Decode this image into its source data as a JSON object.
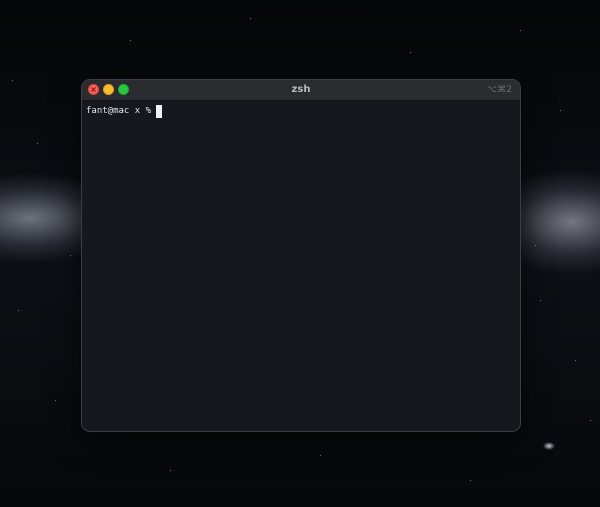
{
  "window": {
    "title": "zsh",
    "shortcut": "⌥⌘2"
  },
  "terminal": {
    "prompt": "fant@mac x %",
    "input": ""
  },
  "colors": {
    "background": "#16181d",
    "titlebar": "#2b2c30",
    "close": "#fe5f57",
    "minimize": "#febc2e",
    "maximize": "#28c840",
    "text": "#e6e6e6"
  },
  "icons": {
    "close": "close-icon",
    "minimize": "minimize-icon",
    "maximize": "maximize-icon",
    "cursor": "text-cursor"
  }
}
